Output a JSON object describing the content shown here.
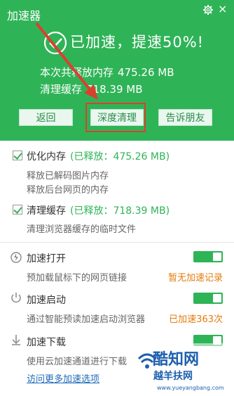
{
  "app": {
    "title": "加速器",
    "settings_icon": "gear-icon",
    "close_label": "×"
  },
  "result": {
    "headline": "已加速，提速50%!",
    "stats": [
      {
        "label": "本次共释放内存",
        "value": "475.26 MB"
      },
      {
        "label": "清理缓存",
        "value": "718.39 MB"
      }
    ]
  },
  "actions": {
    "back": "返回",
    "deep_clean": "深度清理",
    "share": "告诉朋友"
  },
  "options": {
    "memory": {
      "title": "优化内存",
      "released": "(已释放：475.26 MB)",
      "desc1": "释放已解码图片内存",
      "desc2": "释放后台网页的内存"
    },
    "cache": {
      "title": "清理缓存",
      "released": "(已释放：718.39 MB)",
      "desc1": "清理浏览器缓存的临时文件"
    }
  },
  "features": [
    {
      "title": "加速打开",
      "desc": "预加载鼠标下的网页链接",
      "status": "暂无加速记录",
      "icon": "power-icon"
    },
    {
      "title": "加速启动",
      "desc": "通过智能预读加速启动浏览器",
      "status": "已加速363次",
      "icon": "power-icon"
    },
    {
      "title": "加速下载",
      "desc": "使用云加速通道进行下载",
      "status": "",
      "icon": "download-icon"
    }
  ],
  "link": "访问更多加速选项",
  "watermark": {
    "text": "酷知网",
    "sub": "越羊扶网",
    "url": "www.yueyangbang.com"
  },
  "colors": {
    "brand_green": "#2fb357",
    "status_orange": "#e37b0e",
    "highlight_red": "#d9412f"
  }
}
